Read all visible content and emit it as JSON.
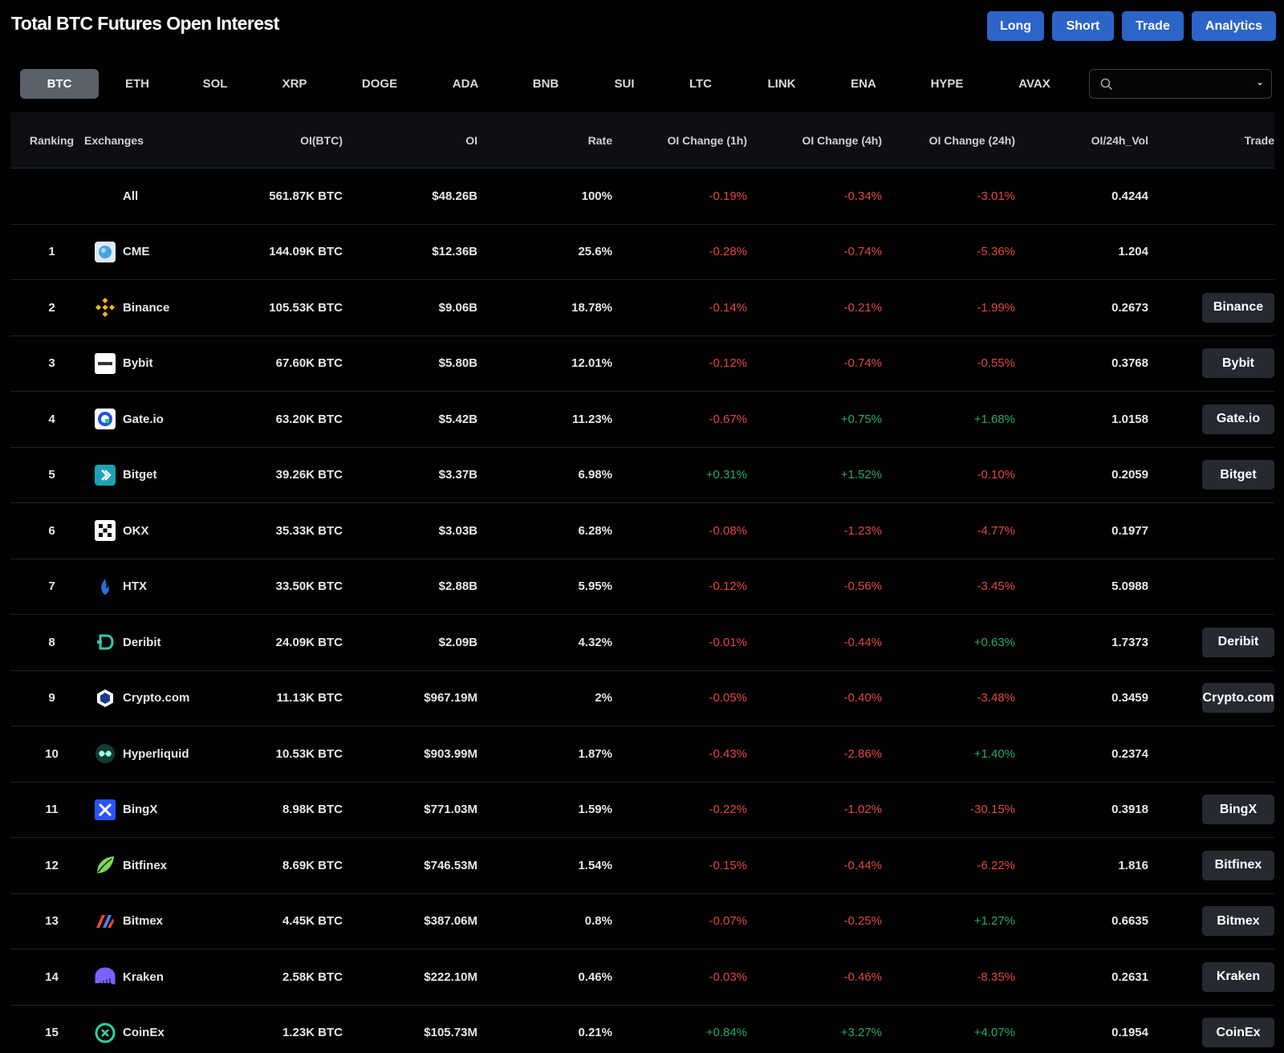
{
  "title": "Total BTC Futures Open Interest",
  "header_buttons": [
    "Long",
    "Short",
    "Trade",
    "Analytics"
  ],
  "coin_tabs": [
    "BTC",
    "ETH",
    "SOL",
    "XRP",
    "DOGE",
    "ADA",
    "BNB",
    "SUI",
    "LTC",
    "LINK",
    "ENA",
    "HYPE",
    "AVAX"
  ],
  "active_tab": "BTC",
  "search": {
    "value": "",
    "placeholder": ""
  },
  "columns": [
    "Ranking",
    "Exchanges",
    "OI(BTC)",
    "OI",
    "Rate",
    "OI Change (1h)",
    "OI Change (4h)",
    "OI Change (24h)",
    "OI/24h_Vol",
    "Trade"
  ],
  "summary": {
    "exchange": "All",
    "oi_btc": "561.87K BTC",
    "oi": "$48.26B",
    "rate": "100%",
    "ch1": "-0.19%",
    "ch4": "-0.34%",
    "ch24": "-3.01%",
    "vol": "0.4244"
  },
  "rows": [
    {
      "rank": "1",
      "exchange": "CME",
      "icon": "cme-icon",
      "oi_btc": "144.09K BTC",
      "oi": "$12.36B",
      "rate": "25.6%",
      "ch1": "-0.28%",
      "ch4": "-0.74%",
      "ch24": "-5.36%",
      "vol": "1.204",
      "trade": ""
    },
    {
      "rank": "2",
      "exchange": "Binance",
      "icon": "binance-icon",
      "oi_btc": "105.53K BTC",
      "oi": "$9.06B",
      "rate": "18.78%",
      "ch1": "-0.14%",
      "ch4": "-0.21%",
      "ch24": "-1.99%",
      "vol": "0.2673",
      "trade": "Binance"
    },
    {
      "rank": "3",
      "exchange": "Bybit",
      "icon": "bybit-icon",
      "oi_btc": "67.60K BTC",
      "oi": "$5.80B",
      "rate": "12.01%",
      "ch1": "-0.12%",
      "ch4": "-0.74%",
      "ch24": "-0.55%",
      "vol": "0.3768",
      "trade": "Bybit"
    },
    {
      "rank": "4",
      "exchange": "Gate.io",
      "icon": "gateio-icon",
      "oi_btc": "63.20K BTC",
      "oi": "$5.42B",
      "rate": "11.23%",
      "ch1": "-0.67%",
      "ch4": "+0.75%",
      "ch24": "+1.68%",
      "vol": "1.0158",
      "trade": "Gate.io"
    },
    {
      "rank": "5",
      "exchange": "Bitget",
      "icon": "bitget-icon",
      "oi_btc": "39.26K BTC",
      "oi": "$3.37B",
      "rate": "6.98%",
      "ch1": "+0.31%",
      "ch4": "+1.52%",
      "ch24": "-0.10%",
      "vol": "0.2059",
      "trade": "Bitget"
    },
    {
      "rank": "6",
      "exchange": "OKX",
      "icon": "okx-icon",
      "oi_btc": "35.33K BTC",
      "oi": "$3.03B",
      "rate": "6.28%",
      "ch1": "-0.08%",
      "ch4": "-1.23%",
      "ch24": "-4.77%",
      "vol": "0.1977",
      "trade": ""
    },
    {
      "rank": "7",
      "exchange": "HTX",
      "icon": "htx-icon",
      "oi_btc": "33.50K BTC",
      "oi": "$2.88B",
      "rate": "5.95%",
      "ch1": "-0.12%",
      "ch4": "-0.56%",
      "ch24": "-3.45%",
      "vol": "5.0988",
      "trade": ""
    },
    {
      "rank": "8",
      "exchange": "Deribit",
      "icon": "deribit-icon",
      "oi_btc": "24.09K BTC",
      "oi": "$2.09B",
      "rate": "4.32%",
      "ch1": "-0.01%",
      "ch4": "-0.44%",
      "ch24": "+0.63%",
      "vol": "1.7373",
      "trade": "Deribit"
    },
    {
      "rank": "9",
      "exchange": "Crypto.com",
      "icon": "cryptocom-icon",
      "oi_btc": "11.13K BTC",
      "oi": "$967.19M",
      "rate": "2%",
      "ch1": "-0.05%",
      "ch4": "-0.40%",
      "ch24": "-3.48%",
      "vol": "0.3459",
      "trade": "Crypto.com"
    },
    {
      "rank": "10",
      "exchange": "Hyperliquid",
      "icon": "hyperliquid-icon",
      "oi_btc": "10.53K BTC",
      "oi": "$903.99M",
      "rate": "1.87%",
      "ch1": "-0.43%",
      "ch4": "-2.86%",
      "ch24": "+1.40%",
      "vol": "0.2374",
      "trade": ""
    },
    {
      "rank": "11",
      "exchange": "BingX",
      "icon": "bingx-icon",
      "oi_btc": "8.98K BTC",
      "oi": "$771.03M",
      "rate": "1.59%",
      "ch1": "-0.22%",
      "ch4": "-1.02%",
      "ch24": "-30.15%",
      "vol": "0.3918",
      "trade": "BingX"
    },
    {
      "rank": "12",
      "exchange": "Bitfinex",
      "icon": "bitfinex-icon",
      "oi_btc": "8.69K BTC",
      "oi": "$746.53M",
      "rate": "1.54%",
      "ch1": "-0.15%",
      "ch4": "-0.44%",
      "ch24": "-6.22%",
      "vol": "1.816",
      "trade": "Bitfinex"
    },
    {
      "rank": "13",
      "exchange": "Bitmex",
      "icon": "bitmex-icon",
      "oi_btc": "4.45K BTC",
      "oi": "$387.06M",
      "rate": "0.8%",
      "ch1": "-0.07%",
      "ch4": "-0.25%",
      "ch24": "+1.27%",
      "vol": "0.6635",
      "trade": "Bitmex"
    },
    {
      "rank": "14",
      "exchange": "Kraken",
      "icon": "kraken-icon",
      "oi_btc": "2.58K BTC",
      "oi": "$222.10M",
      "rate": "0.46%",
      "ch1": "-0.03%",
      "ch4": "-0.46%",
      "ch24": "-8.35%",
      "vol": "0.2631",
      "trade": "Kraken"
    },
    {
      "rank": "15",
      "exchange": "CoinEx",
      "icon": "coinex-icon",
      "oi_btc": "1.23K BTC",
      "oi": "$105.73M",
      "rate": "0.21%",
      "ch1": "+0.84%",
      "ch4": "+3.27%",
      "ch24": "+4.07%",
      "vol": "0.1954",
      "trade": "CoinEx"
    }
  ],
  "colors": {
    "accent": "#2c64c8",
    "negative": "#e04646",
    "positive": "#26a86a",
    "tab_active": "#5b6169",
    "trade_button": "#262a30"
  }
}
